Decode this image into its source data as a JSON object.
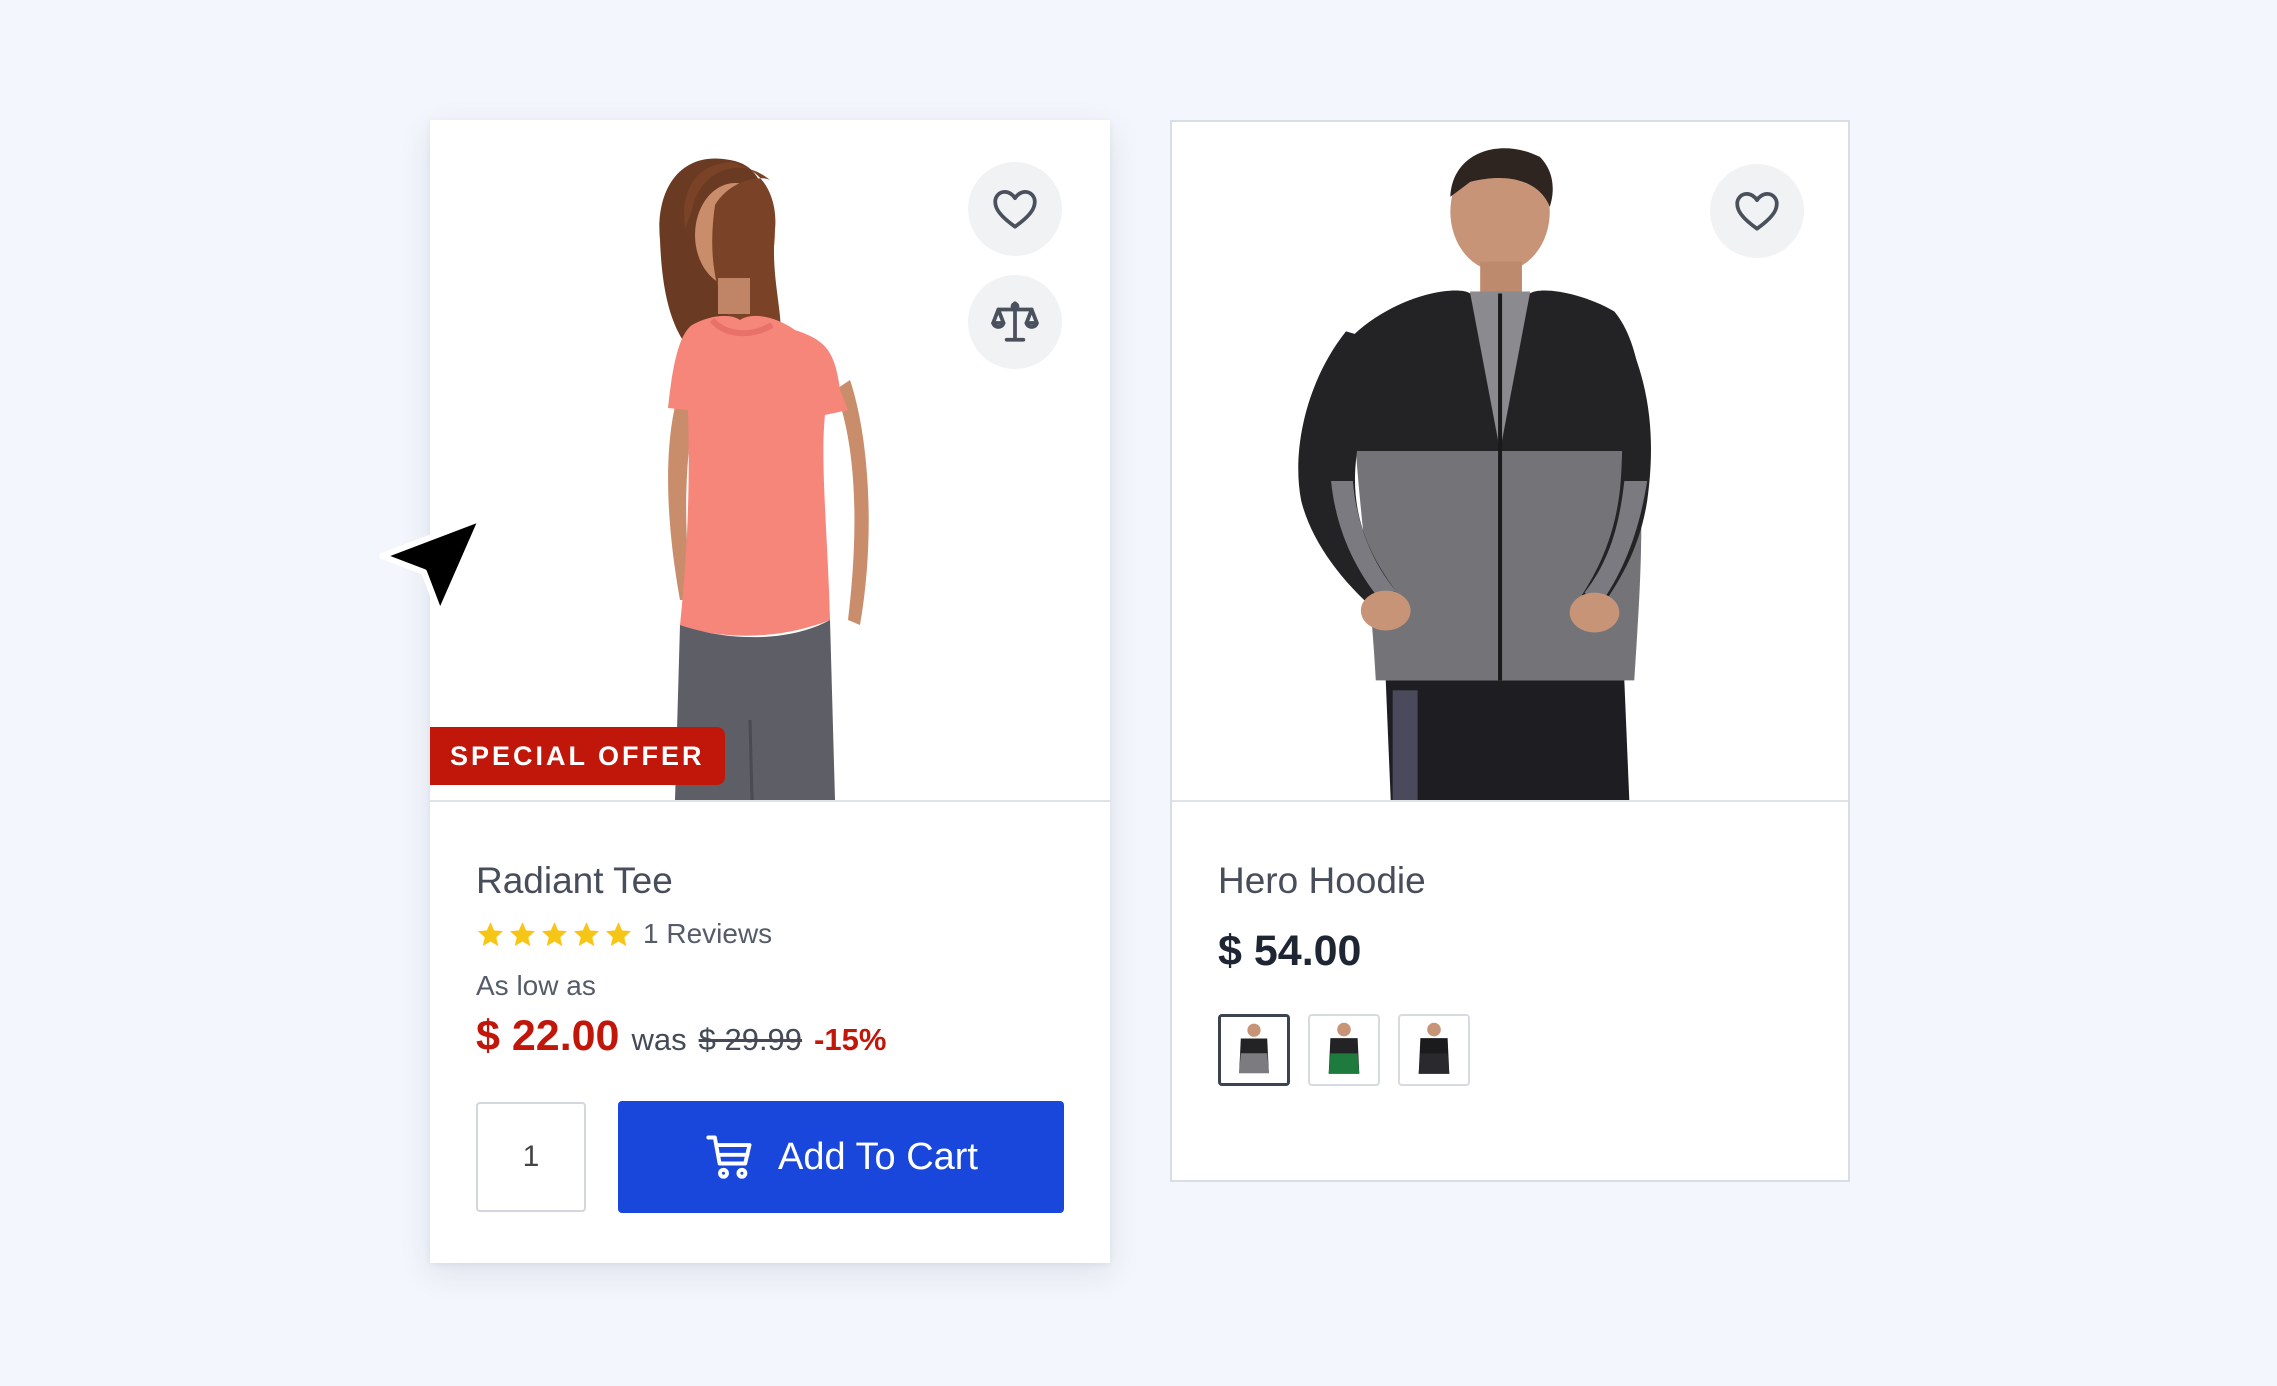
{
  "products": [
    {
      "name": "Radiant Tee",
      "badge": "SPECIAL OFFER",
      "rating_stars": 5,
      "reviews": "1 Reviews",
      "as_low_as": "As low as",
      "price": "$ 22.00",
      "was_label": "was",
      "old_price": "$ 29.99",
      "discount": "-15%",
      "quantity": "1",
      "add_to_cart": "Add To Cart",
      "icons": [
        "heart-icon",
        "compare-scale-icon",
        "cart-icon"
      ]
    },
    {
      "name": "Hero Hoodie",
      "price": "$ 54.00",
      "swatches": [
        "gray",
        "green",
        "black"
      ],
      "icons": [
        "heart-icon"
      ]
    }
  ],
  "colors": {
    "background": "#f3f6fc",
    "accent_red": "#c1170b",
    "button_blue": "#1a47db",
    "star_yellow": "#f5c518"
  }
}
